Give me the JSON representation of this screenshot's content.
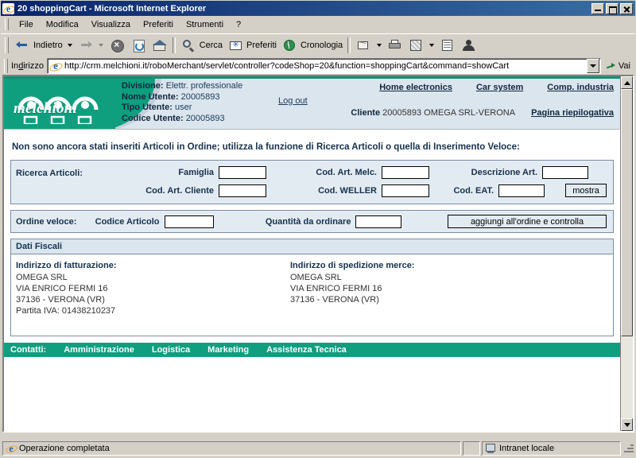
{
  "window": {
    "title": "20 shoppingCart - Microsoft Internet Explorer",
    "icon": "ie-document-icon",
    "minimize": "_",
    "maximize": "□",
    "close": "×"
  },
  "menu": {
    "items": [
      {
        "label": "File",
        "accel": "F"
      },
      {
        "label": "Modifica",
        "accel": "M"
      },
      {
        "label": "Visualizza",
        "accel": "V"
      },
      {
        "label": "Preferiti",
        "accel": "P"
      },
      {
        "label": "Strumenti",
        "accel": "S"
      },
      {
        "label": "?",
        "accel": ""
      }
    ]
  },
  "toolbar": {
    "back_label": "Indietro",
    "forward_label": "",
    "stop_label": "",
    "refresh_label": "",
    "home_label": "",
    "search_label": "Cerca",
    "favorites_label": "Preferiti",
    "history_label": "Cronologia",
    "mail_label": "",
    "print_label": "",
    "edit_label": "",
    "discuss_label": "",
    "messenger_label": ""
  },
  "address": {
    "label": "Indirizzo",
    "accel": "d",
    "url": "http://crm.melchioni.it/roboMerchant/servlet/controller?codeShop=20&function=shoppingCart&command=showCart",
    "go_label": "Vai"
  },
  "site_header": {
    "logo_text": "melchioni",
    "divisione_label": "Divisione:",
    "divisione_value": "Elettr. professionale",
    "nome_utente_label": "Nome Utente:",
    "nome_utente_value": "20005893",
    "tipo_utente_label": "Tipo Utente:",
    "tipo_utente_value": "user",
    "codice_utente_label": "Codice Utente:",
    "codice_utente_value": "20005893",
    "logout_label": "Log out",
    "nav": [
      {
        "label": "Home electronics"
      },
      {
        "label": "Car system"
      },
      {
        "label": "Comp. industria"
      }
    ],
    "cliente_label": "Cliente",
    "cliente_value": "20005893 OMEGA SRL-VERONA",
    "riepilogativa_label": "Pagina riepilogativa"
  },
  "notice": "Non sono ancora stati inseriti Articoli in Ordine; utilizza la funzione di Ricerca Articoli o quella di Inserimento Veloce:",
  "search_panel": {
    "title": "Ricerca Articoli:",
    "fields": {
      "famiglia_label": "Famiglia",
      "famiglia_value": "",
      "cod_art_melc_label": "Cod. Art. Melc.",
      "cod_art_melc_value": "",
      "descrizione_art_label": "Descrizione Art.",
      "descrizione_art_value": "",
      "cod_art_cliente_label": "Cod. Art. Cliente",
      "cod_art_cliente_value": "",
      "cod_weller_label": "Cod. WELLER",
      "cod_weller_value": "",
      "cod_eat_label": "Cod. EAT.",
      "cod_eat_value": ""
    },
    "submit_label": "mostra"
  },
  "fast_order": {
    "title": "Ordine veloce:",
    "codice_articolo_label": "Codice Articolo",
    "codice_articolo_value": "",
    "quantita_label": "Quantità da ordinare",
    "quantita_value": "",
    "submit_label": "aggiungi all'ordine e controlla"
  },
  "dati_fiscali": {
    "header": "Dati Fiscali",
    "billing": {
      "heading": "Indirizzo di fatturazione:",
      "lines": [
        "OMEGA SRL",
        "VIA ENRICO FERMI 16",
        "37136 - VERONA (VR)",
        "Partita IVA: 01438210237"
      ]
    },
    "shipping": {
      "heading": "Indirizzo di spedizione merce:",
      "lines": [
        "OMEGA SRL",
        "VIA ENRICO FERMI 16",
        "37136 - VERONA (VR)"
      ]
    }
  },
  "site_footer": {
    "lead": "Contatti:",
    "links": [
      {
        "label": "Amministrazione"
      },
      {
        "label": "Logistica"
      },
      {
        "label": "Marketing"
      },
      {
        "label": "Assistenza Tecnica"
      }
    ]
  },
  "status_bar": {
    "message": "Operazione completata",
    "zone": "Intranet locale"
  },
  "colors": {
    "brand_green": "#0f9e7e",
    "header_blue": "#dbe5ee",
    "panel_blue": "#e3ebf2",
    "text_dark_blue": "#16314e",
    "titlebar_blue": "#0a246a"
  }
}
